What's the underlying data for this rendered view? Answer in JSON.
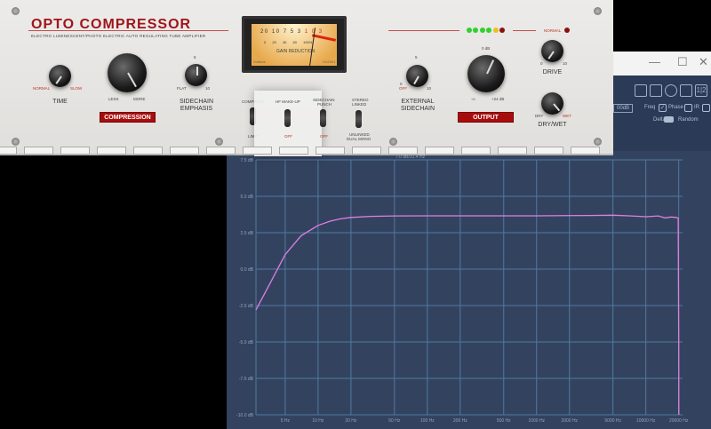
{
  "window": {
    "minimize": "—",
    "maximize": "☐",
    "close": "✕"
  },
  "plugin": {
    "title": "OPTO COMPRESSOR",
    "subtitle": "ELECTRO LUMINESCENT/PHOTO ELECTRIC AUTO REGULATING TUBE AMPLIFIER",
    "time": {
      "label": "TIME",
      "min": "NORMAL",
      "max": "SLOW"
    },
    "compression": {
      "label": "COMPRESSION",
      "min": "LESS",
      "max": "MORE"
    },
    "sidechain_emphasis": {
      "label1": "SIDECHAIN",
      "label2": "EMPHASIS",
      "min": "FLAT",
      "mid": "5",
      "max": "10"
    },
    "meter": {
      "scale": [
        "20",
        "10",
        "7",
        "5",
        "3",
        "1",
        "0",
        "3"
      ],
      "sub": [
        "0",
        "20",
        "40",
        "60",
        "100%"
      ],
      "label": "GAIN REDUCTION",
      "brand": "Softube",
      "model": "VU2001"
    },
    "switches": {
      "compress": "COMPRESS",
      "limit": "LIMIT",
      "hf_makeup": "HF MAKE-UP",
      "hf_off": "OFF",
      "sc_punch1": "SIDECHAIN",
      "sc_punch2": "PUNCH",
      "sc_off": "OFF",
      "stereo1": "STEREO",
      "stereo2": "LINKED",
      "unlinked1": "UNLINKED",
      "unlinked2": "DUAL MONO"
    },
    "external_sidechain": {
      "label1": "EXTERNAL",
      "label2": "SIDECHAIN",
      "min": "0",
      "off": "OFF",
      "mid": "5",
      "max": "10"
    },
    "output": {
      "label": "OUTPUT",
      "top": "0 dB",
      "min": "-∞",
      "max": "+24 dB"
    },
    "drive": {
      "label": "DRIVE",
      "normal": "NORMAL",
      "min": "0",
      "max": "10"
    },
    "drywet": {
      "label": "DRY/WET",
      "min": "DRY",
      "max": "WET"
    },
    "leds": [
      "#2fd12f",
      "#2fd12f",
      "#2fd12f",
      "#2fd12f",
      "#e8c21c",
      "#8a1010"
    ]
  },
  "toolbar": {
    "range": "00dB",
    "freq": "Freq",
    "phase": "Phase",
    "ir": "IR",
    "delta": "Delta",
    "random": "Random",
    "page": "1|2"
  },
  "chart_data": {
    "type": "line",
    "readout": "7.0 dB/31.4 Hz",
    "xscale": "log",
    "xlim": [
      2.7,
      20500
    ],
    "ylim": [
      -10,
      7.5
    ],
    "xticks": [
      5,
      10,
      20,
      50,
      100,
      200,
      500,
      1000,
      2000,
      5000,
      10000,
      20000
    ],
    "xtick_labels": [
      "5 Hz",
      "10 Hz",
      "20 Hz",
      "50 Hz",
      "100 Hz",
      "200 Hz",
      "500 Hz",
      "1000 Hz",
      "2000 Hz",
      "5000 Hz",
      "10000 Hz",
      "20000 Hz"
    ],
    "yticks": [
      7.5,
      5,
      2.5,
      0,
      -2.5,
      -5,
      -7.5,
      -10
    ],
    "ytick_labels": [
      "7.5 dB",
      "5.0 dB",
      "2.5 dB",
      "0.0 dB",
      "-2.5 dB",
      "-5.0 dB",
      "-7.5 dB",
      "-10.0 dB"
    ],
    "series": [
      {
        "name": "magnitude",
        "color": "#e07ee0",
        "x": [
          2.7,
          3.5,
          5,
          7,
          10,
          13,
          16,
          20,
          30,
          50,
          100,
          1000,
          3000,
          5000,
          7000,
          10000,
          13000,
          15000,
          17000,
          19000,
          19800,
          20000,
          20050
        ],
        "y": [
          -2.8,
          -1.2,
          1.0,
          2.3,
          3.0,
          3.3,
          3.45,
          3.55,
          3.62,
          3.65,
          3.66,
          3.66,
          3.68,
          3.7,
          3.66,
          3.6,
          3.65,
          3.52,
          3.58,
          3.55,
          3.5,
          -5,
          -10
        ]
      }
    ]
  }
}
